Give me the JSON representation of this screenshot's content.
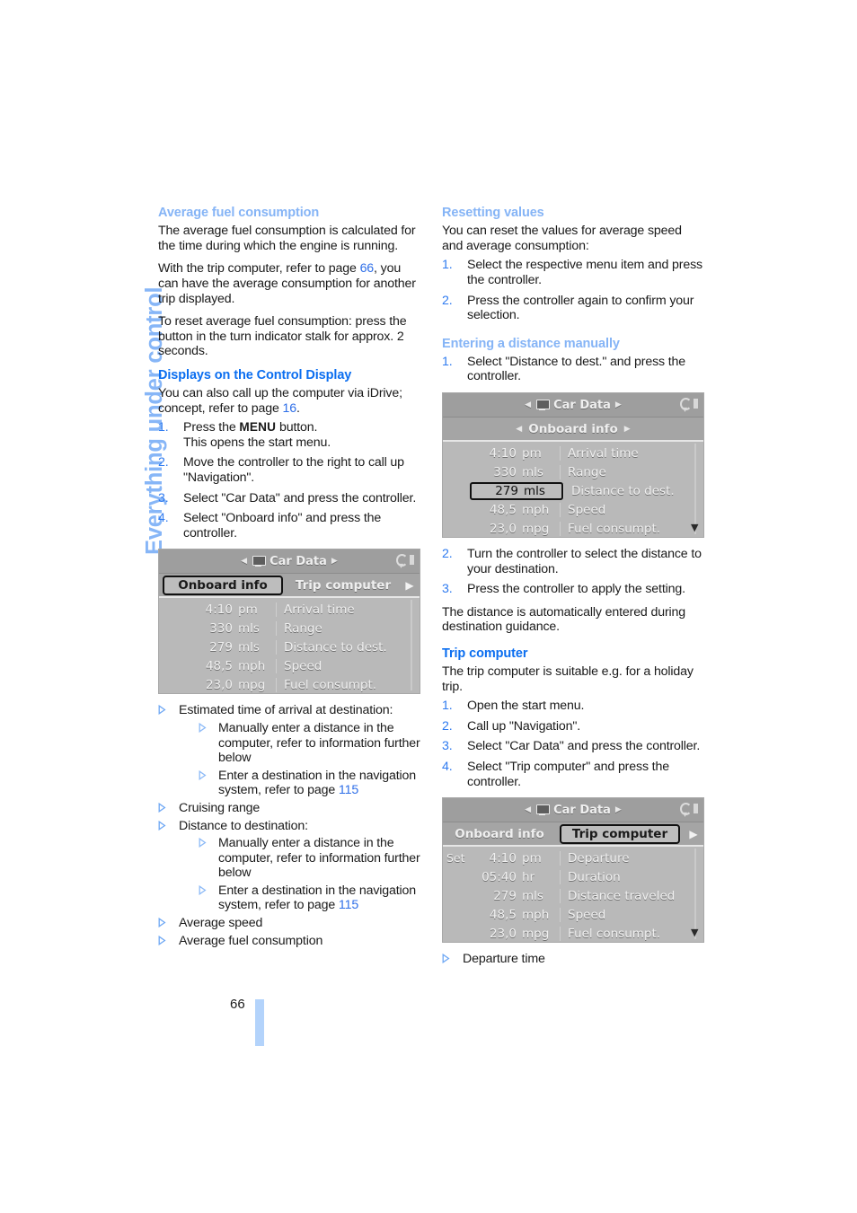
{
  "running_head": "Everything under control",
  "folio": "66",
  "colors": {
    "heading_light": "#85b4f6",
    "heading_strong": "#0b6ef0",
    "page_ref": "#2f6fe8",
    "bullet": "#6fa8f4",
    "folio_bar": "#b3d3fb"
  },
  "left_column": {
    "section_avg_fuel": {
      "heading": "Average fuel consumption",
      "p1": "The average fuel consumption is calculated for the time during which the engine is running.",
      "p2_a": "With the trip computer, refer to page ",
      "p2_ref": "66",
      "p2_b": ", you can have the average consumption for another trip displayed.",
      "p3": "To reset average fuel consumption: press the button in the turn indicator stalk for approx. 2 seconds."
    },
    "section_displays": {
      "heading": "Displays on the Control Display",
      "p1_a": "You can also call up the computer via iDrive; concept, refer to page ",
      "p1_ref": "16",
      "p1_b": ".",
      "steps": [
        {
          "num": "1.",
          "text_a": "Press the ",
          "key": "MENU",
          "text_b": " button.",
          "text_line2": "This opens the start menu."
        },
        {
          "num": "2.",
          "text_a": "Move the controller to the right to call up \"Navigation\".",
          "key": "",
          "text_b": "",
          "text_line2": ""
        },
        {
          "num": "3.",
          "text_a": "Select \"Car Data\" and press the controller.",
          "key": "",
          "text_b": "",
          "text_line2": ""
        },
        {
          "num": "4.",
          "text_a": "Select \"Onboard info\" and press the controller.",
          "key": "",
          "text_b": "",
          "text_line2": ""
        }
      ]
    },
    "screenshot1": {
      "title": "Car Data",
      "title_icon": "monitor-icon",
      "tabs": [
        {
          "label": "Onboard info",
          "selected": true
        },
        {
          "label": "Trip computer",
          "selected": false
        }
      ],
      "tab_more_arrow": "▶",
      "rows": [
        {
          "set": "",
          "value": "4:10",
          "unit": "pm",
          "label": "Arrival time",
          "selected": false
        },
        {
          "set": "",
          "value": "330",
          "unit": "mls",
          "label": "Range",
          "selected": false
        },
        {
          "set": "",
          "value": "279",
          "unit": "mls",
          "label": "Distance to dest.",
          "selected": false
        },
        {
          "set": "",
          "value": "48,5",
          "unit": "mph",
          "label": "Speed",
          "selected": false
        },
        {
          "set": "",
          "value": "23,0",
          "unit": "mpg",
          "label": "Fuel consumpt.",
          "selected": false
        }
      ]
    },
    "bullets": [
      {
        "text": "Estimated time of arrival at destination:",
        "children": [
          {
            "text": "Manually enter a distance in the computer, refer to information further below",
            "ref": ""
          },
          {
            "text": "Enter a destination in the navigation system, refer to page ",
            "ref": "115"
          }
        ]
      },
      {
        "text": "Cruising range",
        "children": []
      },
      {
        "text": "Distance to destination:",
        "children": [
          {
            "text": "Manually enter a distance in the computer, refer to information further below",
            "ref": ""
          },
          {
            "text": "Enter a destination in the navigation system, refer to page ",
            "ref": "115"
          }
        ]
      },
      {
        "text": "Average speed",
        "children": []
      },
      {
        "text": "Average fuel consumption",
        "children": []
      }
    ]
  },
  "right_column": {
    "section_resetting": {
      "heading": "Resetting values",
      "p1": "You can reset the values for average speed and average consumption:",
      "steps": [
        {
          "num": "1.",
          "text": "Select the respective menu item and press the controller."
        },
        {
          "num": "2.",
          "text": "Press the controller again to confirm your selection."
        }
      ]
    },
    "section_distance": {
      "heading": "Entering a distance manually",
      "steps_before": [
        {
          "num": "1.",
          "text": "Select \"Distance to dest.\" and press the controller."
        }
      ],
      "steps_after": [
        {
          "num": "2.",
          "text": "Turn the controller to select the distance to your destination."
        },
        {
          "num": "3.",
          "text": "Press the controller to apply the setting."
        }
      ],
      "p_after": "The distance is automatically entered during destination guidance."
    },
    "screenshot2": {
      "title": "Car Data",
      "title_icon": "monitor-icon",
      "submenu": "Onboard info",
      "rows": [
        {
          "set": "",
          "value": "4:10",
          "unit": "pm",
          "label": "Arrival time",
          "selected": false
        },
        {
          "set": "",
          "value": "330",
          "unit": "mls",
          "label": "Range",
          "selected": false
        },
        {
          "set": "",
          "value": "279",
          "unit": "mls",
          "label": "Distance to dest.",
          "selected": true
        },
        {
          "set": "",
          "value": "48,5",
          "unit": "mph",
          "label": "Speed",
          "selected": false
        },
        {
          "set": "",
          "value": "23,0",
          "unit": "mpg",
          "label": "Fuel consumpt.",
          "selected": false
        }
      ]
    },
    "section_trip": {
      "heading": "Trip computer",
      "p1": "The trip computer is suitable e.g. for a holiday trip.",
      "steps": [
        {
          "num": "1.",
          "text": "Open the start menu."
        },
        {
          "num": "2.",
          "text": "Call up \"Navigation\"."
        },
        {
          "num": "3.",
          "text": "Select \"Car Data\" and press the controller."
        },
        {
          "num": "4.",
          "text": "Select \"Trip computer\" and press the controller."
        }
      ]
    },
    "screenshot3": {
      "title": "Car Data",
      "title_icon": "monitor-icon",
      "tabs": [
        {
          "label": "Onboard info",
          "selected": false
        },
        {
          "label": "Trip computer",
          "selected": true
        }
      ],
      "tab_more_arrow": "▶",
      "rows": [
        {
          "set": "Set",
          "value": "4:10",
          "unit": "pm",
          "label": "Departure",
          "selected": false
        },
        {
          "set": "",
          "value": "05:40",
          "unit": "hr",
          "label": "Duration",
          "selected": false
        },
        {
          "set": "",
          "value": "279",
          "unit": "mls",
          "label": "Distance traveled",
          "selected": false
        },
        {
          "set": "",
          "value": "48,5",
          "unit": "mph",
          "label": "Speed",
          "selected": false
        },
        {
          "set": "",
          "value": "23,0",
          "unit": "mpg",
          "label": "Fuel consumpt.",
          "selected": false
        }
      ]
    },
    "bullets_after": [
      {
        "text": "Departure time"
      }
    ]
  }
}
